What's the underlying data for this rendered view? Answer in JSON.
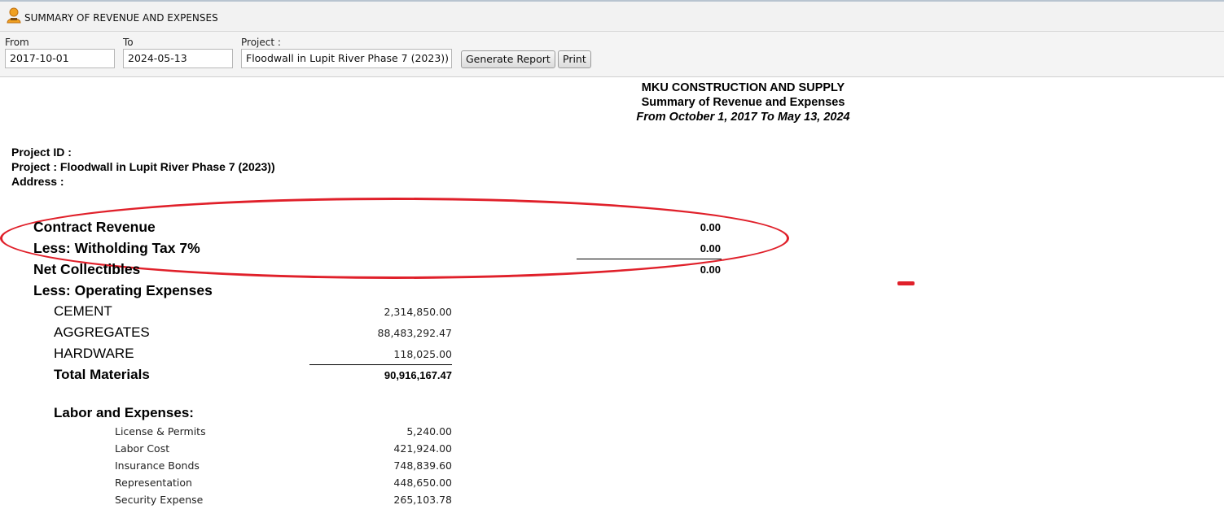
{
  "window": {
    "title": "SUMMARY OF REVENUE AND EXPENSES"
  },
  "filters": {
    "from_label": "From",
    "from_value": "2017-10-01",
    "to_label": "To",
    "to_value": "2024-05-13",
    "project_label": "Project :",
    "project_value": "Floodwall in Lupit River Phase 7 (2023)) ·",
    "generate_button": "Generate Report",
    "print_button": "Print"
  },
  "report": {
    "company": "MKU CONSTRUCTION AND SUPPLY",
    "subtitle": "Summary of Revenue and Expenses",
    "period": "From October 1, 2017 To May 13, 2024",
    "project_id": "Project ID :",
    "project": "Project : Floodwall in Lupit River Phase 7 (2023))",
    "address": "Address :",
    "revenue": {
      "contract_label": "Contract Revenue",
      "contract_value": "0.00",
      "tax_label": "Less: Witholding Tax 7%",
      "tax_value": "0.00",
      "net_label": "Net Collectibles",
      "net_value": "0.00"
    },
    "operating_label": "Less: Operating Expenses",
    "materials": [
      {
        "label": "CEMENT",
        "value": "2,314,850.00"
      },
      {
        "label": "AGGREGATES",
        "value": "88,483,292.47"
      },
      {
        "label": "HARDWARE",
        "value": "118,025.00"
      }
    ],
    "total_materials_label": "Total Materials",
    "total_materials_value": "90,916,167.47",
    "labor_label": "Labor and Expenses:",
    "labor": [
      {
        "label": "License & Permits",
        "value": "5,240.00"
      },
      {
        "label": "Labor Cost",
        "value": "421,924.00"
      },
      {
        "label": "Insurance Bonds",
        "value": "748,839.60"
      },
      {
        "label": "Representation",
        "value": "448,650.00"
      },
      {
        "label": "Security Expense",
        "value": "265,103.78"
      }
    ]
  },
  "colors": {
    "annotation_red": "#e0202a"
  }
}
